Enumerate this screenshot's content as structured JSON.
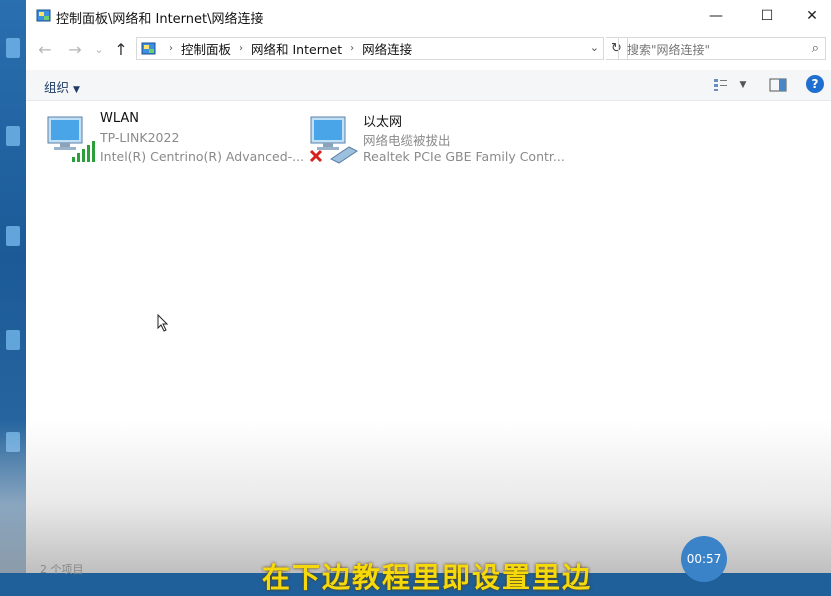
{
  "window": {
    "title": "控制面板\\网络和 Internet\\网络连接",
    "buttons": {
      "minimize": "—",
      "maximize": "☐",
      "close": "✕"
    }
  },
  "nav": {
    "back": "←",
    "forward": "→",
    "recent": "⌄",
    "up": "↑",
    "breadcrumbs": [
      "控制面板",
      "网络和 Internet",
      "网络连接"
    ],
    "separator": "›",
    "dropdown": "⌄",
    "refresh": "↻"
  },
  "search": {
    "placeholder": "搜索\"网络连接\"",
    "icon": "⌕"
  },
  "toolbar": {
    "organize_label": "组织",
    "organize_caret": "▼",
    "view_caret": "▼",
    "help": "?"
  },
  "adapters": [
    {
      "name": "WLAN",
      "status": "TP-LINK2022",
      "device": "Intel(R) Centrino(R) Advanced-..."
    },
    {
      "name": "以太网",
      "status": "网络电缆被拔出",
      "device": "Realtek PCIe GBE Family Contr..."
    }
  ],
  "overlay": {
    "timer": "00:57",
    "caption": "在下边教程里即设置里边",
    "statusbar": "2 个项目"
  },
  "colors": {
    "accent": "#1f6fd1",
    "signal": "#2e9e3a",
    "error": "#d4231c"
  }
}
